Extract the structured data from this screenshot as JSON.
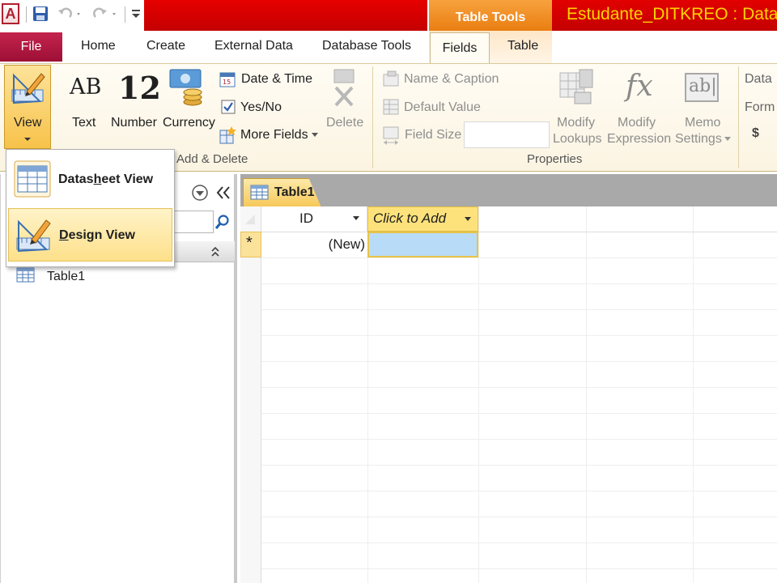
{
  "app": {
    "icon_letter": "A",
    "document_title": "Estudante_DITKREO : Datab",
    "contextual_tab_group": "Table Tools"
  },
  "tabs": {
    "file": "File",
    "home": "Home",
    "create": "Create",
    "external_data": "External Data",
    "database_tools": "Database Tools",
    "fields": "Fields",
    "table": "Table"
  },
  "ribbon": {
    "views_group": {
      "view_label": "View"
    },
    "add_delete_group": {
      "label": "Add & Delete",
      "text": "Text",
      "number": "Number",
      "number_glyph": "12",
      "text_glyph": "AB",
      "currency": "Currency",
      "date_time": "Date & Time",
      "yes_no": "Yes/No",
      "more_fields": "More Fields",
      "delete": "Delete"
    },
    "properties_group": {
      "label": "Properties",
      "name_caption": "Name & Caption",
      "default_value": "Default Value",
      "field_size": "Field Size",
      "field_size_value": "",
      "modify_lookups_1": "Modify",
      "modify_lookups_2": "Lookups",
      "modify_expression_1": "Modify",
      "modify_expression_2": "Expression",
      "memo_settings_1": "Memo",
      "memo_settings_2": "Settings",
      "fx_glyph": "fx",
      "ab_glyph": "ab|"
    },
    "formatting_group": {
      "data_type_partial": "Data",
      "format_partial": "Form",
      "currency_symbol": "$"
    }
  },
  "view_menu": {
    "items": [
      {
        "label": "Datasheet View",
        "hotkey_letter": "h"
      },
      {
        "label": "Design View",
        "hotkey_letter": "D"
      }
    ]
  },
  "nav_pane": {
    "objects": [
      {
        "name": "Table1",
        "type": "table"
      }
    ]
  },
  "document": {
    "tab_title": "Table1",
    "columns": [
      "ID",
      "Click to Add"
    ],
    "new_row": {
      "marker": "*",
      "id_value": "(New)"
    }
  },
  "colors": {
    "title_red": "#d40000",
    "contextual_orange": "#f39a2e",
    "file_tab": "#b41a44",
    "selection_yellow": "#fde27c",
    "active_cell_blue": "#b8dcf7",
    "doc_title_yellow": "#ffd400"
  }
}
